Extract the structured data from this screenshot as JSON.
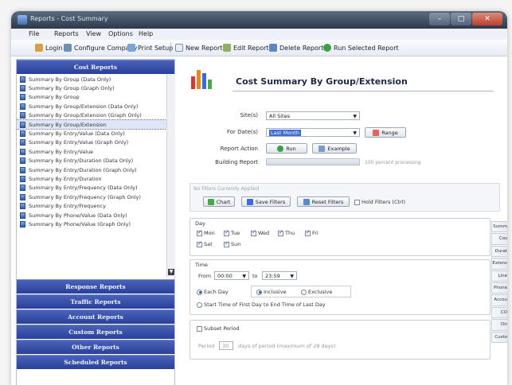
{
  "window": {
    "title": "Reports - Cost Summary"
  },
  "menu": [
    "File",
    "Reports",
    "View",
    "Options",
    "Help"
  ],
  "toolbar": {
    "login": "Login",
    "configure": "Configure Company",
    "print_setup": "Print Setup",
    "new_report": "New Report",
    "edit_report": "Edit Report",
    "delete_report": "Delete Report",
    "run_selected": "Run Selected Report"
  },
  "sidebar": {
    "cost_header": "Cost Reports",
    "items": [
      "Summary By Group (Data Only)",
      "Summary By Group (Graph Only)",
      "Summary By Group",
      "Summary By Group/Extension (Data Only)",
      "Summary By Group/Extension (Graph Only)",
      "Summary By Group/Extension",
      "Summary By Entry/Value (Data Only)",
      "Summary By Entry/Value (Graph Only)",
      "Summary By Entry/Value",
      "Summary By Entry/Duration (Data Only)",
      "Summary By Entry/Duration (Graph Only)",
      "Summary By Entry/Duration",
      "Summary By Entry/Frequency (Data Only)",
      "Summary By Entry/Frequency (Graph Only)",
      "Summary By Entry/Frequency",
      "Summary By Phone/Value (Data Only)",
      "Summary By Phone/Value (Graph Only)"
    ],
    "selected_index": 5,
    "sections": [
      "Response Reports",
      "Traffic Reports",
      "Account Reports",
      "Custom Reports",
      "Other Reports",
      "Scheduled Reports"
    ]
  },
  "report": {
    "title": "Cost Summary By Group/Extension",
    "sites_label": "Site(s)",
    "sites_value": "All Sites",
    "dates_label": "For Date(s)",
    "dates_value": "Last Month",
    "range_button": "Range",
    "action_label": "Report Action",
    "run_button": "Run",
    "example_button": "Example",
    "building_label": "Building Report",
    "building_status": "100 percent processing"
  },
  "filters": {
    "status": "No Filters Currently Applied",
    "chart_button": "Chart",
    "save_button": "Save Filters",
    "reset_button": "Reset Filters",
    "hold_label": "Hold Filters (Ctrl)"
  },
  "day": {
    "title": "Day",
    "days": [
      {
        "label": "Mon",
        "checked": true
      },
      {
        "label": "Tue",
        "checked": true
      },
      {
        "label": "Wed",
        "checked": true
      },
      {
        "label": "Thu",
        "checked": true
      },
      {
        "label": "Fri",
        "checked": true
      },
      {
        "label": "Sat",
        "checked": true
      },
      {
        "label": "Sun",
        "checked": true
      }
    ]
  },
  "time": {
    "title": "Time",
    "from_label": "From",
    "from_value": "00:00",
    "to_label": "to",
    "to_value": "23:59",
    "each_day": "Each Day",
    "inclusive": "Inclusive",
    "exclusive": "Exclusive",
    "start_end": "Start Time of First Day to End Time of Last Day"
  },
  "subset": {
    "title": "Subset Period",
    "label": "Period",
    "value": "30",
    "note": "days of period (maximum of 28 days)"
  },
  "side_tabs": [
    "Summ",
    "Cos",
    "Durat",
    "Extens",
    "Line",
    "Phone",
    "Accou",
    "CO",
    "Dir",
    "Custo"
  ],
  "colors": {
    "header_blue": "#28409a",
    "accent": "#3b6bd6"
  }
}
